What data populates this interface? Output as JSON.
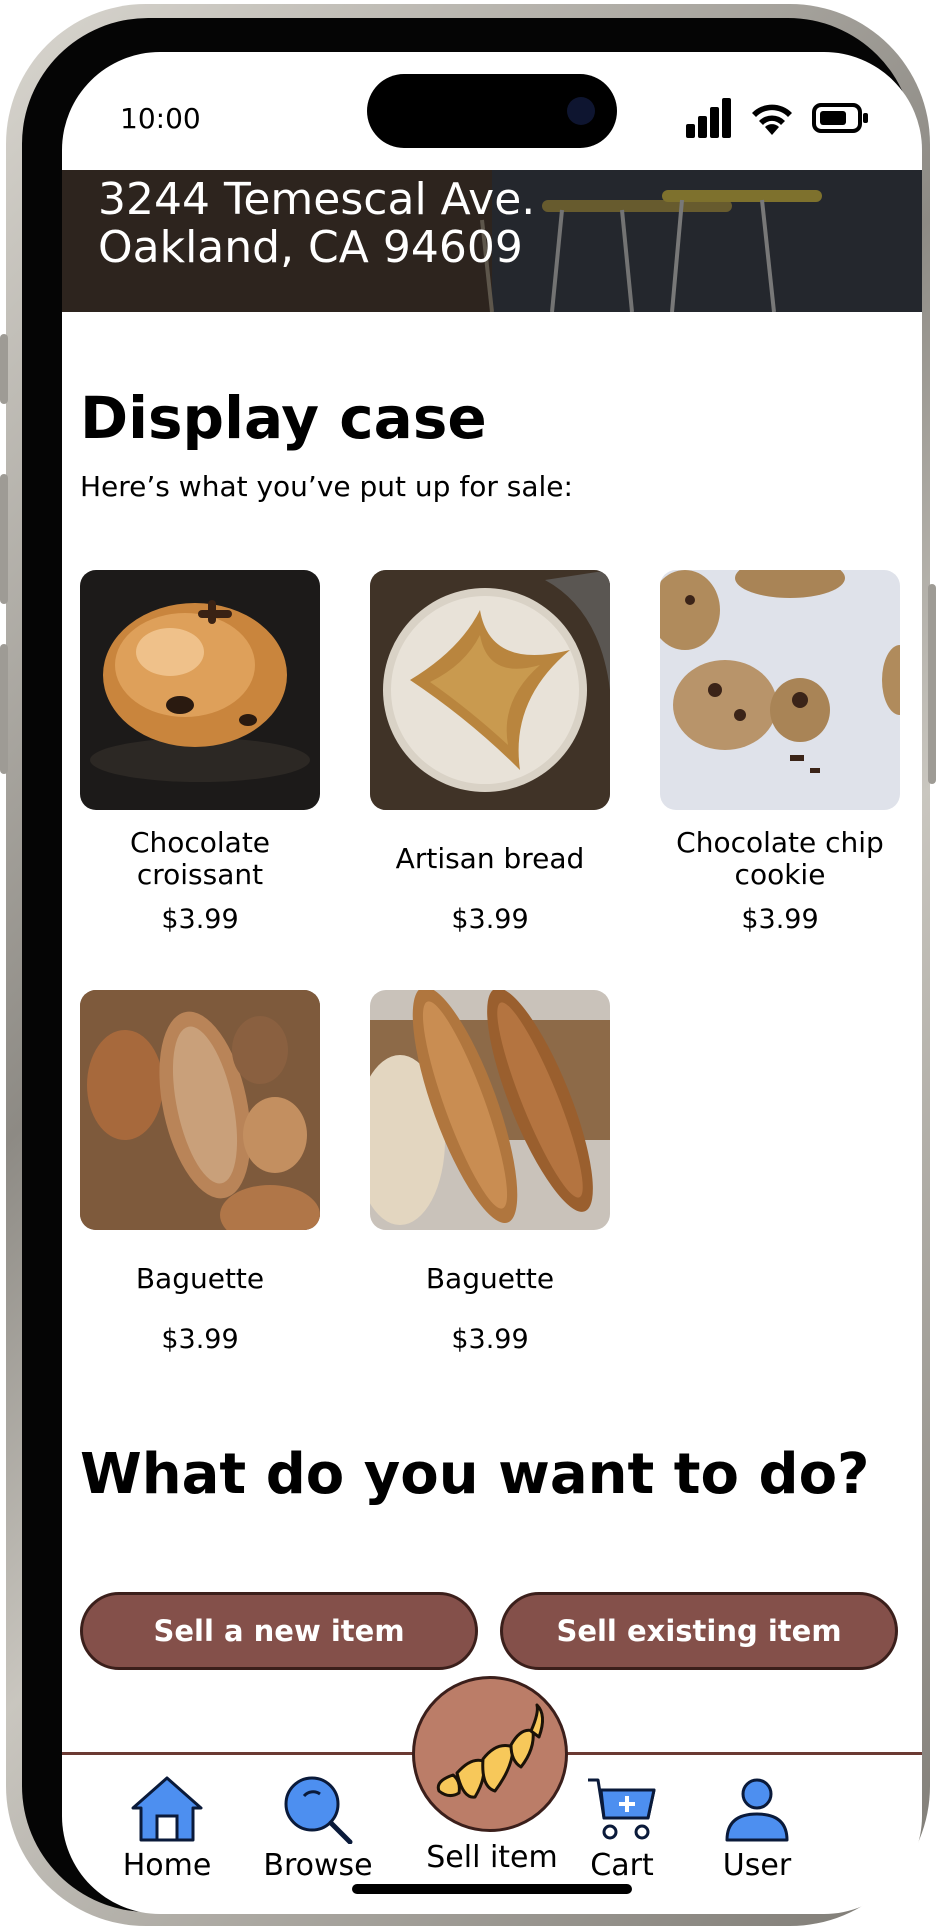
{
  "status_bar": {
    "time": "10:00"
  },
  "location": {
    "address_line1": "3244 Temescal Ave.",
    "address_line2": "Oakland, CA 94609"
  },
  "display_case": {
    "title": "Display case",
    "subtitle": "Here’s what you’ve put up for sale:",
    "items": [
      {
        "name": "Chocolate croissant",
        "price": "$3.99"
      },
      {
        "name": "Artisan bread",
        "price": "$3.99"
      },
      {
        "name": "Chocolate chip cookie",
        "price": "$3.99"
      },
      {
        "name": "Baguette",
        "price": "$3.99"
      },
      {
        "name": "Baguette",
        "price": "$3.99"
      }
    ]
  },
  "actions": {
    "title": "What do you want to do?",
    "sell_new": "Sell a new item",
    "sell_existing": "Sell existing item"
  },
  "tabs": [
    {
      "label": "Home",
      "icon": "home-icon"
    },
    {
      "label": "Browse",
      "icon": "search-icon"
    },
    {
      "label": "Sell item",
      "icon": "croissant-icon"
    },
    {
      "label": "Cart",
      "icon": "cart-icon"
    },
    {
      "label": "User",
      "icon": "user-icon"
    }
  ],
  "colors": {
    "brand_brown": "#84504a",
    "sell_circle": "#bb7d68",
    "icon_blue": "#4d8ff0",
    "croissant_yellow": "#f7c85a"
  }
}
